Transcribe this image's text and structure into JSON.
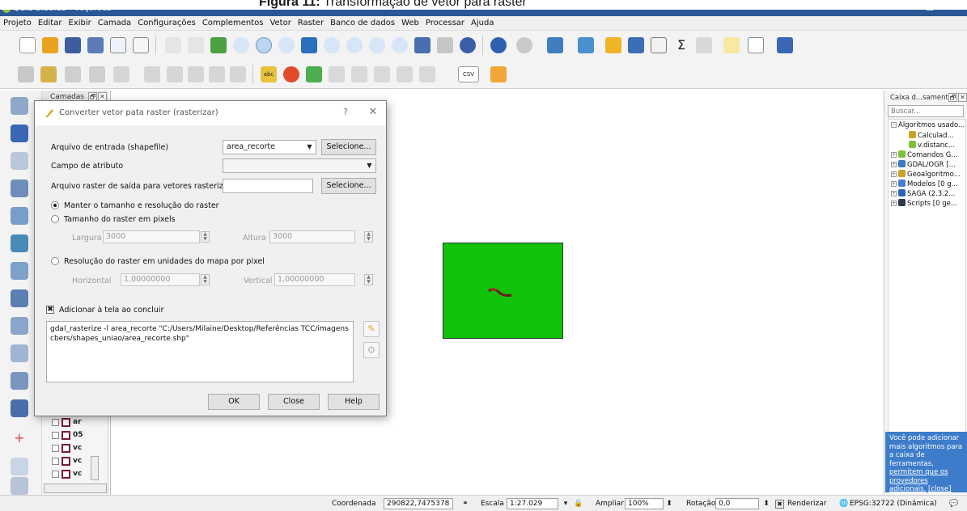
{
  "caption": {
    "prefix": "Figura 11:",
    "text": "Transformação de vetor para raster"
  },
  "window": {
    "title": "QGIS 2.18.13 - voçoroca",
    "minimize": "—",
    "maximize": "☐",
    "close": "✕"
  },
  "menubar": [
    "Projeto",
    "Editar",
    "Exibir",
    "Camada",
    "Configurações",
    "Complementos",
    "Vetor",
    "Raster",
    "Banco de dados",
    "Web",
    "Processar",
    "Ajuda"
  ],
  "toolbar": {
    "csv_label": "CSV",
    "abc_label": "abc",
    "sigma": "Σ"
  },
  "layers_panel": {
    "title": "Camadas",
    "float": "🗗",
    "close": "✕",
    "items": [
      {
        "name": "ar"
      },
      {
        "name": "05"
      },
      {
        "name": "vc"
      },
      {
        "name": "vc"
      },
      {
        "name": "vc"
      }
    ]
  },
  "dialog": {
    "title": "Converter vetor pata raster (rasterizar)",
    "help": "?",
    "close": "✕",
    "input_label": "Arquivo de entrada (shapefile)",
    "input_value": "area_recorte",
    "select_btn": "Selecione...",
    "attr_label": "Campo de atributo",
    "attr_value": "",
    "output_label": "Arquivo raster de saída para vetores rasterizados",
    "output_value": "",
    "select_btn2": "Selecione...",
    "radio1": "Manter o tamanho e resolução do raster",
    "radio2": "Tamanho do raster em pixels",
    "width_label": "Largura",
    "width_value": "3000",
    "height_label": "Altura",
    "height_value": "3000",
    "radio3": "Resolução do raster em unidades do mapa por pixel",
    "horizontal_label": "Horizontal",
    "horizontal_value": "1,00000000",
    "vertical_label": "Vertical",
    "vertical_value": "1,00000000",
    "add_checkbox_label": "Adicionar à tela ao concluir",
    "add_checked": "✖",
    "command": "gdal_rasterize -l area_recorte \"C:/Users/Milaine/Desktop/Referências TCC/imagens cbers/shapes_uniao/area_recorte.shp\"",
    "ok": "OK",
    "close_btn": "Close",
    "help_btn": "Help"
  },
  "toolbox": {
    "title": "Caixa d...samento",
    "float": "🗗",
    "close": "✕",
    "search_placeholder": "Buscar...",
    "tree": [
      {
        "label": "Algoritmos usado...",
        "indent": 0,
        "exp": "−",
        "icon": ""
      },
      {
        "label": "Calculad...",
        "indent": 22,
        "exp": "",
        "icon": "#c9a227"
      },
      {
        "label": "v.distanc...",
        "indent": 22,
        "exp": "",
        "icon": "#7fbf3f"
      },
      {
        "label": "Comandos G...",
        "indent": 0,
        "exp": "+",
        "icon": "#7fbf3f"
      },
      {
        "label": "GDAL/OGR [...",
        "indent": 0,
        "exp": "+",
        "icon": "#3a78c2"
      },
      {
        "label": "Geoalgoritmo...",
        "indent": 0,
        "exp": "+",
        "icon": "#c9a227"
      },
      {
        "label": "Modelos [0 g...",
        "indent": 0,
        "exp": "+",
        "icon": "#4a7bd0"
      },
      {
        "label": "SAGA (2.3.2...",
        "indent": 0,
        "exp": "+",
        "icon": "#2a66b8"
      },
      {
        "label": "Scripts [0 ge...",
        "indent": 0,
        "exp": "+",
        "icon": "#2e3a4a"
      }
    ],
    "tip_text": "Você pode adicionar mais algoritmos para a caixa de ferramentas,",
    "tip_link": "permitem que os provedores adicionais.",
    "tip_close": "[close]"
  },
  "statusbar": {
    "coord_label": "Coordenada",
    "coord_value": "290822,7475378",
    "scale_label": "Escala",
    "scale_value": "1:27.029",
    "zoom_label": "Ampliar",
    "zoom_value": "100%",
    "rotation_label": "Rotação",
    "rotation_value": "0,0",
    "render_check": "✖",
    "render_label": "Renderizar",
    "crs_label": "EPSG:32722 (Dinâmica)"
  }
}
